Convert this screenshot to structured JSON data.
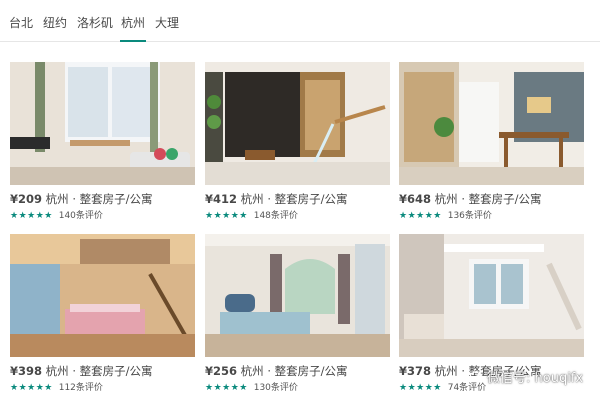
{
  "city_tabs": [
    {
      "label": "台北",
      "active": false
    },
    {
      "label": "纽约",
      "active": false
    },
    {
      "label": "洛杉矶",
      "active": false
    },
    {
      "label": "杭州",
      "active": true
    },
    {
      "label": "大理",
      "active": false
    }
  ],
  "accent_color": "#0a8a7d",
  "listings": [
    {
      "price": "¥209",
      "city": "杭州",
      "type": "整套房子/公寓",
      "stars": "★★★★★",
      "reviews": "140条评价"
    },
    {
      "price": "¥412",
      "city": "杭州",
      "type": "整套房子/公寓",
      "stars": "★★★★★",
      "reviews": "148条评价"
    },
    {
      "price": "¥648",
      "city": "杭州",
      "type": "整套房子/公寓",
      "stars": "★★★★★",
      "reviews": "136条评价"
    },
    {
      "price": "¥398",
      "city": "杭州",
      "type": "整套房子/公寓",
      "stars": "★★★★★",
      "reviews": "112条评价"
    },
    {
      "price": "¥256",
      "city": "杭州",
      "type": "整套房子/公寓",
      "stars": "★★★★★",
      "reviews": "130条评价"
    },
    {
      "price": "¥378",
      "city": "杭州",
      "type": "整套房子/公寓",
      "stars": "★★★★★",
      "reviews": "74条评价"
    }
  ],
  "dot_separator": "·",
  "watermark": {
    "icon": "wechat-icon",
    "text": "微信号: houqifx"
  }
}
